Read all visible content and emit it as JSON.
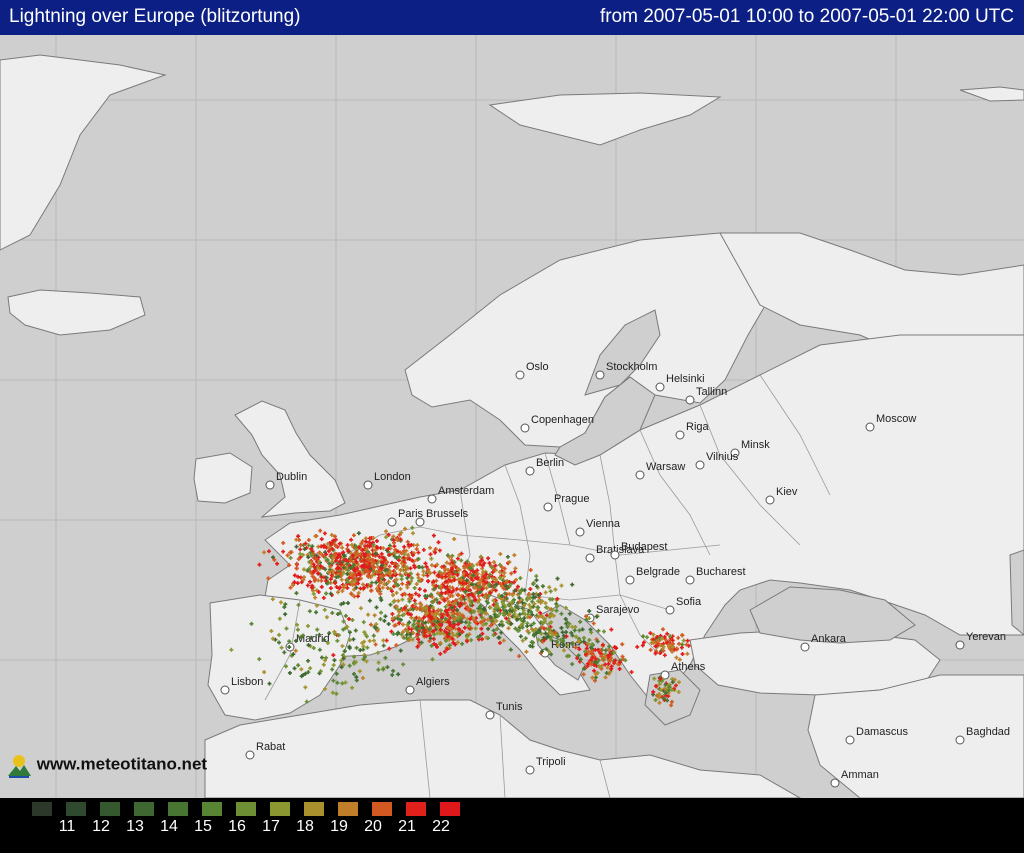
{
  "header": {
    "title": "Lightning over Europe (blitzortung)",
    "range": "from 2007-05-01 10:00 to 2007-05-01 22:00 UTC"
  },
  "colors": {
    "header_bg": "#0c1f84",
    "sea": "#cfcfcf",
    "land": "#eeeeee",
    "border": "#7a7a7a"
  },
  "cities": [
    "London",
    "Dublin",
    "Paris",
    "Brussels",
    "Amsterdam",
    "Berlin",
    "Prague",
    "Vienna",
    "Bratislava",
    "Budapest",
    "Belgrade",
    "Sofia",
    "Sarajevo",
    "Warsaw",
    "Minsk",
    "Vilnius",
    "Riga",
    "Tallinn",
    "Helsinki",
    "Stockholm",
    "Oslo",
    "Copenhagen",
    "Moscow",
    "Kiev",
    "Madrid",
    "Lisbon",
    "Rabat",
    "Algiers",
    "Tunis",
    "Tripoli",
    "Rome",
    "Athens",
    "Ankara",
    "Yerevan",
    "Baghdad",
    "Damascus",
    "Amman",
    "Bucharest"
  ],
  "brand": {
    "text": "www.meteotitano.net"
  },
  "legend": {
    "hours": [
      "11",
      "12",
      "13",
      "14",
      "15",
      "16",
      "17",
      "18",
      "19",
      "20",
      "21",
      "22"
    ],
    "colors": [
      "#2b382a",
      "#2f4a2e",
      "#35582f",
      "#3e6731",
      "#487632",
      "#588433",
      "#6e8f33",
      "#8b9731",
      "#a9912d",
      "#c07e28",
      "#d25a22",
      "#e0201a",
      "#e1181b"
    ]
  }
}
